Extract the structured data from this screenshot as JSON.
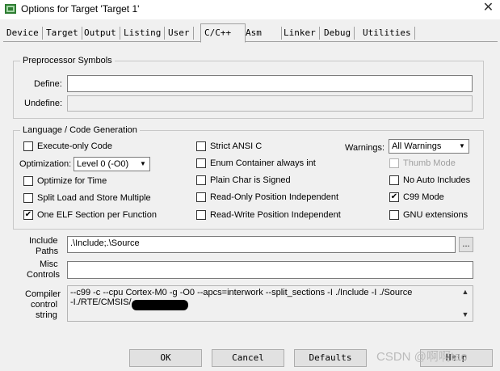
{
  "window": {
    "title": "Options for Target 'Target 1'",
    "close_glyph": "✕"
  },
  "tabs": [
    "Device",
    "Target",
    "Output",
    "Listing",
    "User",
    "C/C++",
    "Asm",
    "Linker",
    "Debug",
    "Utilities"
  ],
  "preprocessor": {
    "group_label": "Preprocessor Symbols",
    "define_label": "Define:",
    "define_value": "",
    "undefine_label": "Undefine:",
    "undefine_value": ""
  },
  "codegen": {
    "group_label": "Language / Code Generation",
    "execute_only": {
      "label": "Execute-only Code",
      "checked": false
    },
    "optimization_label": "Optimization:",
    "optimization_value": "Level 0 (-O0)",
    "optimize_time": {
      "label": "Optimize for Time",
      "checked": false
    },
    "split_load": {
      "label": "Split Load and Store Multiple",
      "checked": false
    },
    "one_elf": {
      "label": "One ELF Section per Function",
      "checked": true
    },
    "strict_ansi": {
      "label": "Strict ANSI C",
      "checked": false
    },
    "enum_container": {
      "label": "Enum Container always int",
      "checked": false
    },
    "plain_char": {
      "label": "Plain Char is Signed",
      "checked": false
    },
    "ro_pos": {
      "label": "Read-Only Position Independent",
      "checked": false
    },
    "rw_pos": {
      "label": "Read-Write Position Independent",
      "checked": false
    },
    "warnings_label": "Warnings:",
    "warnings_value": "All Warnings",
    "thumb_mode": {
      "label": "Thumb Mode",
      "checked": false
    },
    "no_auto_includes": {
      "label": "No Auto Includes",
      "checked": false
    },
    "c99_mode": {
      "label": "C99 Mode",
      "checked": true
    },
    "gnu_ext": {
      "label": "GNU extensions",
      "checked": false
    }
  },
  "include": {
    "label1": "Include",
    "label2": "Paths",
    "value": ".\\Include;.\\Source",
    "browse": "..."
  },
  "misc": {
    "label1": "Misc",
    "label2": "Controls",
    "value": ""
  },
  "compiler": {
    "label1": "Compiler",
    "label2": "control",
    "label3": "string",
    "line1": "--c99 -c --cpu Cortex-M0 -g -O0 --apcs=interwork --split_sections -I ./Include -I ./Source",
    "line2": "-I./RTE/CMSIS/"
  },
  "buttons": {
    "ok": "OK",
    "cancel": "Cancel",
    "defaults": "Defaults",
    "help": "Help"
  },
  "watermark": "CSDN @啊啊tao",
  "check_glyph": "✔"
}
